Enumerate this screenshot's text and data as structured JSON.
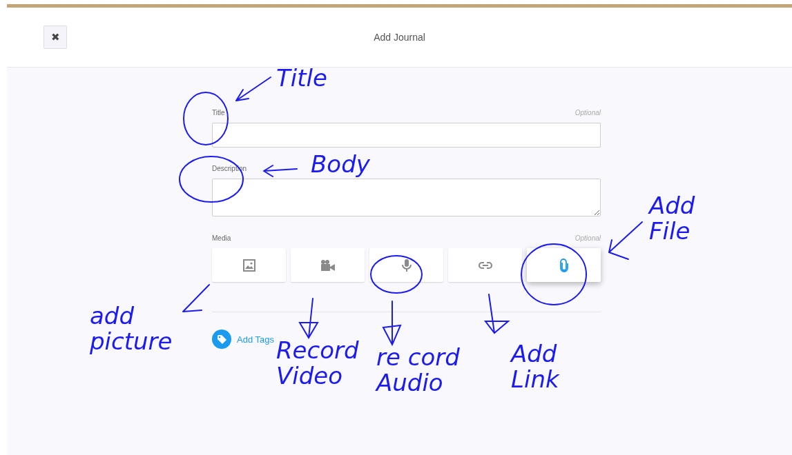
{
  "header": {
    "title": "Add Journal",
    "close": "✖"
  },
  "form": {
    "fields": [
      {
        "label": "Title",
        "hint": "Optional",
        "kind": "input"
      },
      {
        "label": "Description",
        "kind": "textarea"
      }
    ],
    "media": {
      "label": "Media",
      "hint": "Optional",
      "buttons": [
        {
          "kind": "image",
          "selected": false
        },
        {
          "kind": "video",
          "selected": false
        },
        {
          "kind": "audio",
          "selected": false
        },
        {
          "kind": "link",
          "selected": false
        },
        {
          "kind": "file",
          "selected": true
        }
      ]
    },
    "tags_link": "Add Tags"
  },
  "annotations": [
    {
      "text": "Title"
    },
    {
      "text": "Body"
    },
    {
      "text": "Add\nFile"
    },
    {
      "text": "add\npicture"
    },
    {
      "text": "Record\nVideo"
    },
    {
      "text": "re cord\nAudio"
    },
    {
      "text": "Add\nLink"
    }
  ]
}
